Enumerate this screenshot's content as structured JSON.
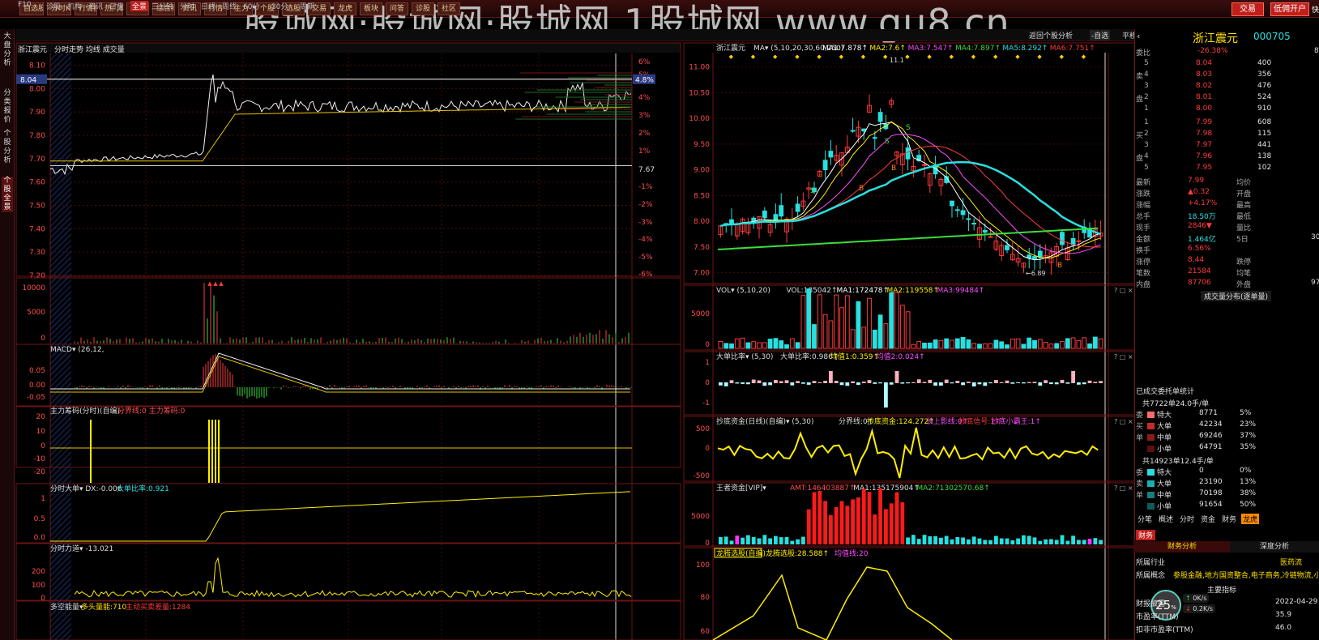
{
  "toolbar": {
    "left_buttons": [
      "自选股",
      "分时K线",
      "行情报价",
      "热门板块",
      "热门题材",
      "综合排名",
      "资讯",
      "行情",
      "主力",
      "个股",
      "选股",
      "交易",
      "龙虎",
      "板块",
      "问答",
      "诊股",
      "社区"
    ],
    "trade_label": "交易",
    "open_account_label": "低佣开户",
    "right_tag": "快"
  },
  "watermark": "股城网·股城网·股城网 1股城网 www.gu8.cn",
  "periods": [
    "F10",
    "诊股",
    "机构",
    "资讯",
    "日盘",
    "全景",
    "三分钟",
    "分时",
    "日线",
    "周线",
    "60分",
    "30分",
    "周期"
  ],
  "period_active": "全景",
  "bar_right": {
    "back": "返回个股分析",
    "list": "-自选",
    "scheme": "平移"
  },
  "left_tabs": [
    "大盘分析",
    "分类报价",
    "个股分析",
    "个股全景"
  ],
  "intraday": {
    "title": "浙江震元",
    "subtitle": "分时走势 均线 成交量",
    "yticks": [
      "8.10",
      "8.04",
      "8.00",
      "7.90",
      "7.80",
      "7.70",
      "7.60",
      "7.50",
      "7.40",
      "7.30",
      "7.20"
    ],
    "pticks": [
      "6%",
      "5%",
      "4.8%",
      "4%",
      "3%",
      "2%",
      "1%",
      "7.67",
      "-1%",
      "-2%",
      "-3%",
      "-4%",
      "-5%",
      "-6%"
    ],
    "cursor_price": "8.04",
    "cursor_pct": "4.8%",
    "vol_ticks": [
      "10000",
      "5000",
      "0"
    ],
    "macd_label": "MACD",
    "macd_params": "(26,12,",
    "macd_ticks": [
      "0.05",
      "0.00",
      "-0.05"
    ],
    "zlcm": {
      "title": "主力筹码(分时)(自编)",
      "text": "分界线:0 主力筹码:0",
      "ticks": [
        "20",
        "10",
        "0",
        "-10",
        "-20"
      ]
    },
    "fsdd": {
      "title": "分时大单",
      "text": "DX:-0.006",
      "text2": "大单比率:0.921",
      "ticks": [
        "1",
        "0.5",
        "0.0"
      ]
    },
    "fsld": {
      "title": "分时力道",
      "text": "-13.021",
      "ticks": [
        "200",
        "100",
        "0"
      ]
    },
    "dkng": {
      "title": "多空能量",
      "text": "多头量能:710",
      "text2": "主动买卖差量:1284"
    }
  },
  "kline": {
    "title": "浙江震元",
    "ma_label": "MA",
    "ma_params": "(5,10,20,30,60,250)",
    "ma_values": [
      "MA1:7.878",
      "MA2:7.6",
      "MA3:7.547",
      "MA4:7.897",
      "MA5:8.292",
      "MA6:7.751"
    ],
    "yticks": [
      "11.00",
      "10.50",
      "10.00",
      "9.50",
      "9.00",
      "8.50",
      "8.00",
      "7.50",
      "7.00"
    ],
    "high_label": "11.1",
    "low_label": "6.89",
    "vol": {
      "title": "VOL",
      "params": "(5,10,20)",
      "values": [
        "VOL:185042",
        "MA1:172478",
        "MA2:119558",
        "MA3:99484"
      ],
      "ticks": [
        "5000",
        "0"
      ]
    },
    "ddb": {
      "title": "大单比率",
      "params": "(5,30)",
      "values": [
        "大单比率:0.986",
        "均值1:0.359",
        "均值2:0.024"
      ],
      "ticks": [
        "1",
        "0",
        "-1"
      ]
    },
    "cdzj": {
      "title": "抄底资金(日线)(自编)",
      "params": "(5,30)",
      "values": [
        "分界线:0",
        "抄底资金:124.272",
        "长上影线:0",
        "抄底信号:1",
        "抄底小霸王:1"
      ],
      "ticks": [
        "500",
        "0",
        "-500"
      ]
    },
    "wwzj": {
      "title": "王者资金[VIP]",
      "values": [
        "AMT:146403887",
        "MA1:135175904",
        "MA2:71302570.68"
      ],
      "ticks": [
        "5000",
        "0"
      ]
    },
    "lzxz": {
      "title": "龙腾选股(自编)",
      "values": [
        "龙腾选股:28.588",
        "均值线:20"
      ],
      "ticks": [
        "100",
        "80",
        "60"
      ]
    }
  },
  "quote": {
    "name": "浙江震元",
    "code": "000705",
    "wb_label": "委比",
    "wb_value": "-26.38%",
    "wb_right": "8",
    "asks": [
      {
        "lv": "5",
        "p": "8.04",
        "v": "400"
      },
      {
        "lv": "4",
        "p": "8.03",
        "v": "356"
      },
      {
        "lv": "3",
        "p": "8.02",
        "v": "476"
      },
      {
        "lv": "2",
        "p": "8.01",
        "v": "524"
      },
      {
        "lv": "1",
        "p": "8.00",
        "v": "910"
      }
    ],
    "bids": [
      {
        "lv": "1",
        "p": "7.99",
        "v": "608"
      },
      {
        "lv": "2",
        "p": "7.98",
        "v": "115"
      },
      {
        "lv": "3",
        "p": "7.97",
        "v": "441"
      },
      {
        "lv": "4",
        "p": "7.96",
        "v": "138"
      },
      {
        "lv": "5",
        "p": "7.95",
        "v": "102"
      }
    ],
    "side_ask": [
      "卖",
      "盘"
    ],
    "side_bid": [
      "买",
      "盘"
    ],
    "stats": [
      [
        "最新",
        "7.99",
        "均价",
        ""
      ],
      [
        "涨跌",
        "▲0.32",
        "开盘",
        ""
      ],
      [
        "涨幅",
        "+4.17%",
        "最高",
        ""
      ],
      [
        "总手",
        "18.50万",
        "最低",
        ""
      ],
      [
        "现手",
        "2846▼",
        "量比",
        ""
      ],
      [
        "金额",
        "1.464亿",
        "5日",
        "30."
      ],
      [
        "换手",
        "6.56%",
        "",
        ""
      ],
      [
        "涨停",
        "8.44",
        "跌停",
        ""
      ],
      [
        "笔数",
        "21584",
        "均笔",
        ""
      ],
      [
        "内盘",
        "87706",
        "外盘",
        "97"
      ]
    ],
    "pie_title": "成交量分布(逐单量)",
    "deal_title": "已成交委托单统计",
    "buy_head": "共7722单24.0手/单",
    "buy_side": [
      "委",
      "买",
      "单"
    ],
    "buy_rows": [
      [
        "特大",
        "8771",
        "5%"
      ],
      [
        "大单",
        "42234",
        "23%"
      ],
      [
        "中单",
        "69246",
        "37%"
      ],
      [
        "小单",
        "64791",
        "35%"
      ]
    ],
    "sell_head": "共14923单12.4手/单",
    "sell_side": [
      "委",
      "卖",
      "单"
    ],
    "sell_rows": [
      [
        "特大",
        "0",
        "0%"
      ],
      [
        "大单",
        "23190",
        "13%"
      ],
      [
        "中单",
        "70198",
        "38%"
      ],
      [
        "小单",
        "91654",
        "50%"
      ]
    ],
    "tabs": [
      "分笔",
      "概述",
      "分时",
      "资金",
      "财务",
      "龙虎"
    ],
    "tab_active": "龙虎",
    "fin_tag": "财务",
    "fin_tabs": [
      "财务分析",
      "深度分析"
    ],
    "fin_rows": [
      [
        "所属行业",
        "医药流"
      ],
      [
        "所属概念",
        "参股金融,地方国资整合,电子商务,冷链物流,小"
      ]
    ],
    "main_idx": "主要指标",
    "fin_rows2": [
      [
        "财报披露",
        "2022-04-29"
      ],
      [
        "市盈率(TTM)",
        "35.9"
      ],
      [
        "扣非市盈率(TTM)",
        "46.0"
      ]
    ],
    "ball": {
      "pct": "25",
      "unit": "%",
      "up": "0",
      "up_unit": "K/s",
      "down": "0.2",
      "down_unit": "K/s"
    }
  },
  "colors": {
    "up": "#ff3b3b",
    "down": "#27e0e0",
    "yellow": "#ffe000",
    "frame": "#6b1515"
  }
}
